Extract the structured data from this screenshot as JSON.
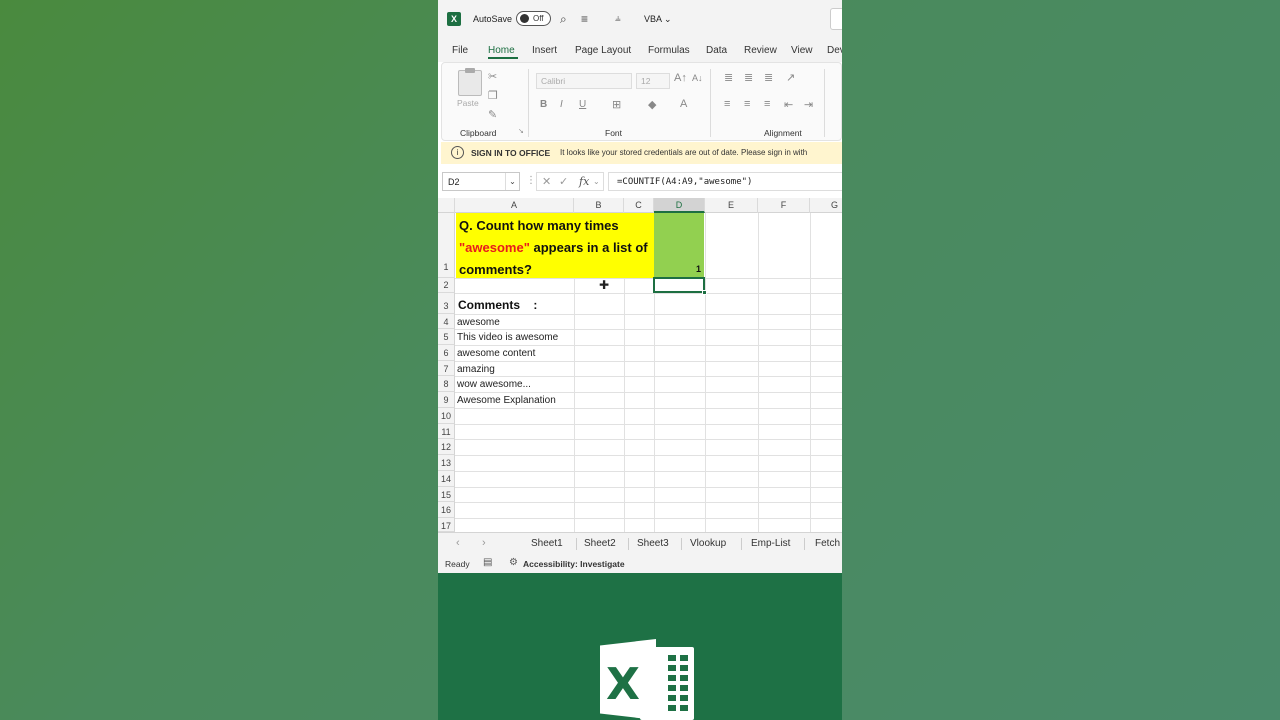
{
  "titlebar": {
    "app_icon": "X",
    "autosave_label": "AutoSave",
    "autosave_state": "Off",
    "file_name": "VBA",
    "icons": [
      "search-icon",
      "format-icon",
      "customize-icon",
      "chevron-down-icon"
    ]
  },
  "menu": {
    "items": [
      "File",
      "Home",
      "Insert",
      "Page Layout",
      "Formulas",
      "Data",
      "Review",
      "View",
      "Dev"
    ],
    "active": "Home"
  },
  "ribbon": {
    "paste_label": "Paste",
    "font_name": "Calibri",
    "font_size": "12",
    "groups": [
      "Clipboard",
      "Font",
      "Alignment"
    ],
    "bold": "B",
    "italic": "I",
    "underline": "U"
  },
  "infobar": {
    "icon": "i",
    "title": "SIGN IN TO OFFICE",
    "message": "It looks like your stored credentials are out of date. Please sign in with"
  },
  "formulabar": {
    "name_box": "D2",
    "fx": "fx",
    "formula": "=COUNTIF(A4:A9,\"awesome\")"
  },
  "grid": {
    "columns": [
      "A",
      "B",
      "C",
      "D",
      "E",
      "F",
      "G"
    ],
    "selected_column": "D",
    "rows": [
      "1",
      "2",
      "3",
      "4",
      "5",
      "6",
      "7",
      "8",
      "9",
      "10",
      "11",
      "12",
      "13",
      "14",
      "15",
      "16",
      "17"
    ],
    "question_prefix": "Q. Count how many times ",
    "question_highlight": "\"awesome\"",
    "question_suffix": " appears in a list of comments?",
    "d1_value": "1",
    "comments_header": "Comments    :",
    "comments": [
      "awesome",
      "This video is awesome",
      "awesome content",
      "amazing",
      "wow awesome...",
      "Awesome Explanation"
    ],
    "highlight_color": "#ffff00",
    "result_color": "#92d050",
    "red_text_color": "#e81c1c"
  },
  "sheets": {
    "tabs": [
      "Sheet1",
      "Sheet2",
      "Sheet3",
      "Vlookup",
      "Emp-List",
      "Fetch"
    ]
  },
  "status": {
    "ready": "Ready",
    "accessibility": "Accessibility: Investigate"
  },
  "brand_color": "#1e7145"
}
